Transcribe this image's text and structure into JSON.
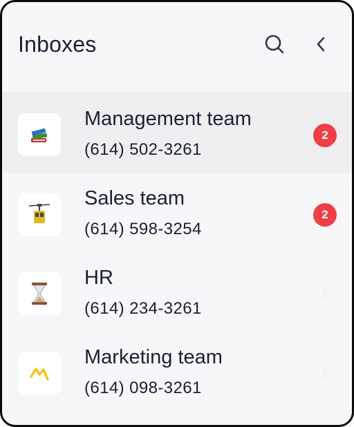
{
  "header": {
    "title": "Inboxes"
  },
  "inboxes": [
    {
      "name": "Management team",
      "phone": "(614) 502-3261",
      "badge": "2",
      "icon": "books-icon",
      "active": true
    },
    {
      "name": "Sales team",
      "phone": "(614) 598-3254",
      "badge": "2",
      "icon": "cable-car-icon",
      "active": false
    },
    {
      "name": "HR",
      "phone": "(614) 234-3261",
      "badge": "2",
      "icon": "hourglass-icon",
      "active": false
    },
    {
      "name": "Marketing team",
      "phone": "(614) 098-3261",
      "badge": "2",
      "icon": "zigzag-icon",
      "active": false
    }
  ],
  "colors": {
    "badge": "#ef3f46",
    "text": "#1a2133",
    "active_row": "#efeef0"
  }
}
